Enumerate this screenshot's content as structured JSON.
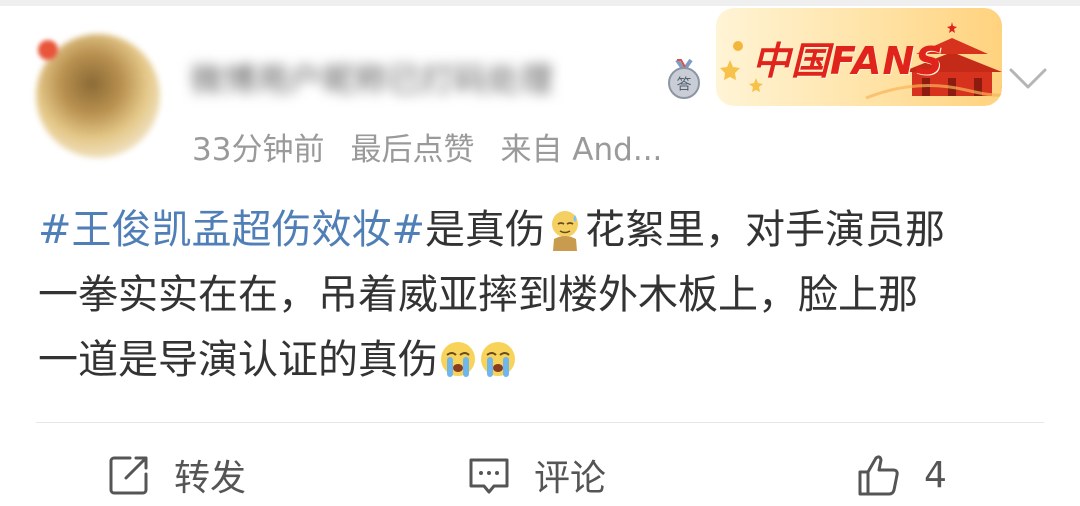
{
  "post": {
    "author_name": "微博用户昵称已打码处理",
    "posted_time": "33分钟前",
    "last_like_label": "最后点赞",
    "source": "来自 And...",
    "fans_badge_text": "中国FANS",
    "content": {
      "hashtag": "#王俊凯孟超伤效妆#",
      "line1_rest": "是真伤",
      "line1_tail": "花絮里，对手演员那",
      "line2": "一拳实实在在，吊着威亚摔到楼外木板上，脸上那",
      "line3": "一道是导演认证的真伤"
    },
    "icons": {
      "medal": "medal-answer-icon",
      "emoji_sweat": "sweat-emoji-icon",
      "emoji_cry": "crying-emoji-icon"
    }
  },
  "actions": {
    "repost_label": "转发",
    "comment_label": "评论",
    "like_count": "4"
  },
  "colors": {
    "hashtag": "#4f7fb6",
    "text": "#333333",
    "meta": "#9a9a9a",
    "badge_red": "#e0231b"
  }
}
